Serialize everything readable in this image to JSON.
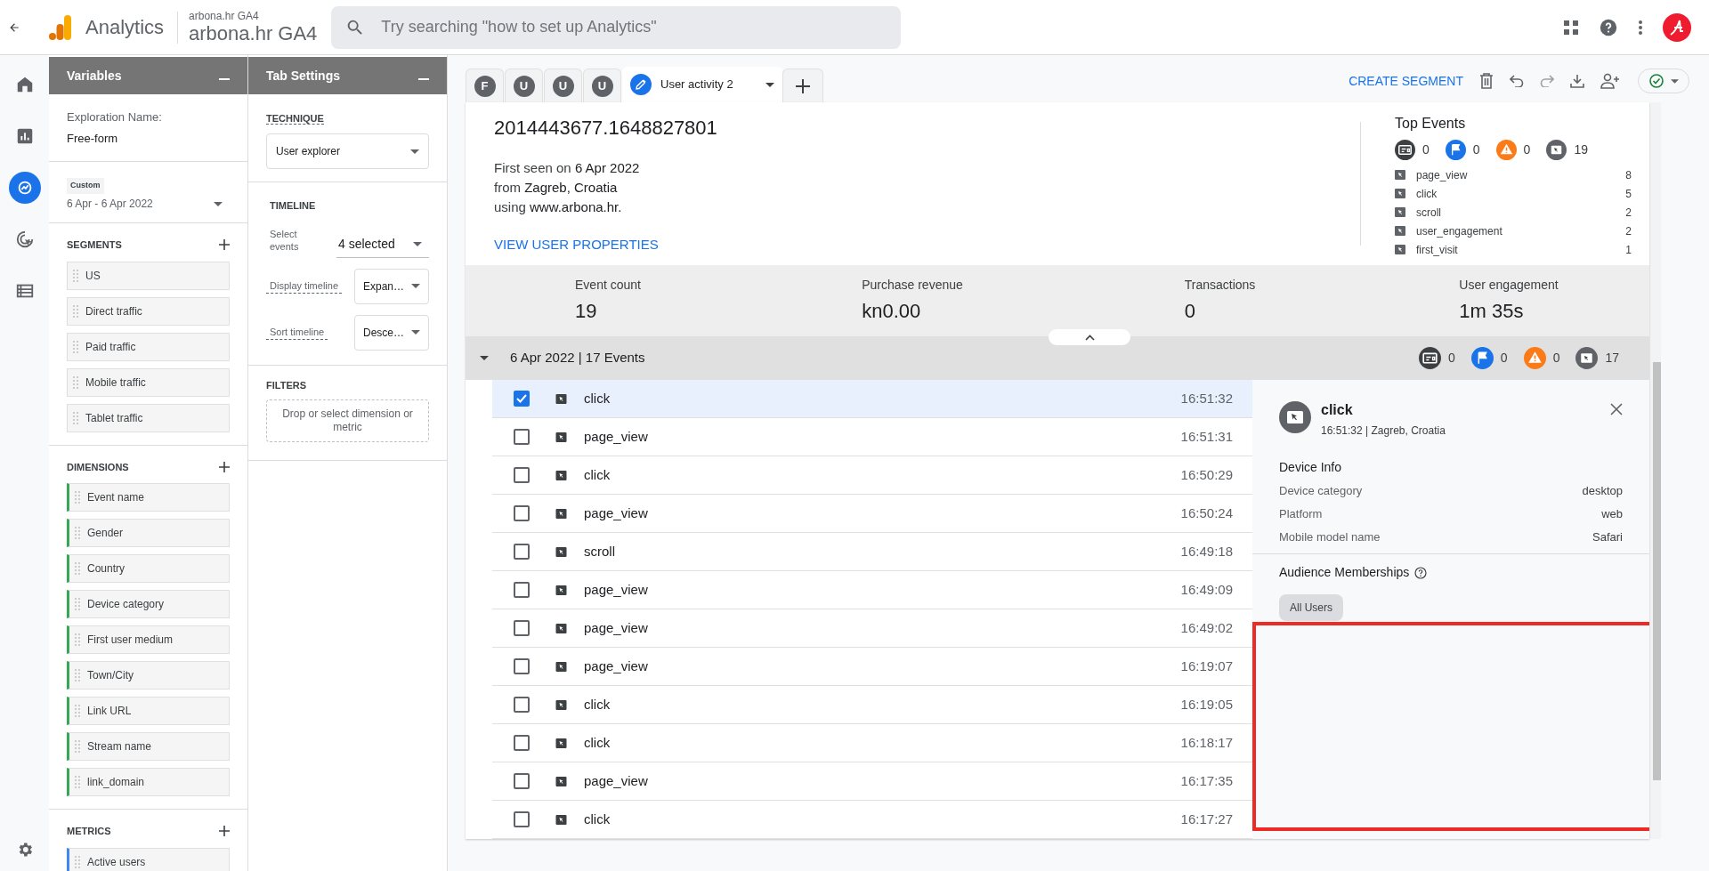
{
  "app": {
    "product": "Analytics",
    "property_small": "arbona.hr GA4",
    "property": "arbona.hr GA4",
    "search_placeholder": "Try searching \"how to set up Analytics\""
  },
  "nav": [
    {
      "kind": "home",
      "selected": false
    },
    {
      "kind": "reports",
      "selected": false
    },
    {
      "kind": "explore",
      "selected": true
    },
    {
      "kind": "advertising",
      "selected": false
    },
    {
      "kind": "configure",
      "selected": false
    }
  ],
  "variables": {
    "title": "Variables",
    "exploration_label": "Exploration Name:",
    "exploration_name": "Free-form",
    "date_badge": "Custom",
    "date_range": "6 Apr - 6 Apr 2022",
    "sections": [
      {
        "title": "SEGMENTS",
        "kind": "segment",
        "items": [
          "US",
          "Direct traffic",
          "Paid traffic",
          "Mobile traffic",
          "Tablet traffic"
        ]
      },
      {
        "title": "DIMENSIONS",
        "kind": "dimension",
        "items": [
          "Event name",
          "Gender",
          "Country",
          "Device category",
          "First user medium",
          "Town/City",
          "Link URL",
          "Stream name",
          "link_domain"
        ]
      },
      {
        "title": "METRICS",
        "kind": "metric",
        "items": [
          "Active users"
        ]
      }
    ]
  },
  "tab_settings": {
    "title": "Tab Settings",
    "technique_label": "TECHNIQUE",
    "technique": "User explorer",
    "timeline_title": "TIMELINE",
    "settings": [
      {
        "label": "Select events",
        "value": "4 selected",
        "kind": "underline"
      },
      {
        "label": "Display timeline",
        "value": "Expan…",
        "kind": "box"
      },
      {
        "label": "Sort timeline",
        "value": "Desce…",
        "kind": "box"
      }
    ],
    "filters_title": "FILTERS",
    "filters_placeholder": "Drop or select dimension or metric"
  },
  "tabs": [
    {
      "label": "F",
      "kind": "initial",
      "selected": false
    },
    {
      "label": "U",
      "kind": "initial",
      "selected": false
    },
    {
      "label": "U",
      "kind": "initial",
      "selected": false
    },
    {
      "label": "U",
      "kind": "initial",
      "selected": false
    },
    {
      "label": "User activity 2",
      "kind": "named",
      "selected": true
    }
  ],
  "toolbar": {
    "create_segment": "CREATE SEGMENT"
  },
  "user": {
    "id": "2014443677.1648827801",
    "lines": [
      "First seen on **6 Apr 2022**",
      "from **Zagreb, Croatia**",
      "using **www.arbona.hr.**"
    ],
    "link": "VIEW USER PROPERTIES"
  },
  "top_events": {
    "title": "Top Events",
    "counts": [
      {
        "kind": "page",
        "count": "0"
      },
      {
        "kind": "conversion",
        "count": "0"
      },
      {
        "kind": "error",
        "count": "0"
      },
      {
        "kind": "click",
        "count": "19"
      }
    ],
    "list": [
      {
        "name": "page_view",
        "count": "8"
      },
      {
        "name": "click",
        "count": "5"
      },
      {
        "name": "scroll",
        "count": "2"
      },
      {
        "name": "user_engagement",
        "count": "2"
      },
      {
        "name": "first_visit",
        "count": "1"
      }
    ]
  },
  "metrics": [
    {
      "label": "Event count",
      "value": "19"
    },
    {
      "label": "Purchase revenue",
      "value": "kn0.00"
    },
    {
      "label": "Transactions",
      "value": "0"
    },
    {
      "label": "User engagement",
      "value": "1m 35s"
    }
  ],
  "group": {
    "title": "6 Apr 2022 | 17 Events",
    "expanded": true,
    "counts": [
      {
        "kind": "page",
        "count": "0"
      },
      {
        "kind": "conversion",
        "count": "0"
      },
      {
        "kind": "error",
        "count": "0"
      },
      {
        "kind": "click",
        "count": "17"
      }
    ]
  },
  "events": [
    {
      "name": "click",
      "time": "16:51:32",
      "checked": true
    },
    {
      "name": "page_view",
      "time": "16:51:31",
      "checked": false
    },
    {
      "name": "click",
      "time": "16:50:29",
      "checked": false
    },
    {
      "name": "page_view",
      "time": "16:50:24",
      "checked": false
    },
    {
      "name": "scroll",
      "time": "16:49:18",
      "checked": false
    },
    {
      "name": "page_view",
      "time": "16:49:09",
      "checked": false
    },
    {
      "name": "page_view",
      "time": "16:49:02",
      "checked": false
    },
    {
      "name": "page_view",
      "time": "16:19:07",
      "checked": false
    },
    {
      "name": "click",
      "time": "16:19:05",
      "checked": false
    },
    {
      "name": "click",
      "time": "16:18:17",
      "checked": false
    },
    {
      "name": "page_view",
      "time": "16:17:35",
      "checked": false
    },
    {
      "name": "click",
      "time": "16:17:27",
      "checked": false
    }
  ],
  "detail": {
    "event": "click",
    "subtitle": "16:51:32 | Zagreb, Croatia",
    "device_title": "Device Info",
    "rows": [
      {
        "label": "Device category",
        "value": "desktop"
      },
      {
        "label": "Platform",
        "value": "web"
      },
      {
        "label": "Mobile model name",
        "value": "Safari"
      }
    ],
    "audience_title": "Audience Memberships",
    "audiences": [
      "All Users"
    ]
  }
}
